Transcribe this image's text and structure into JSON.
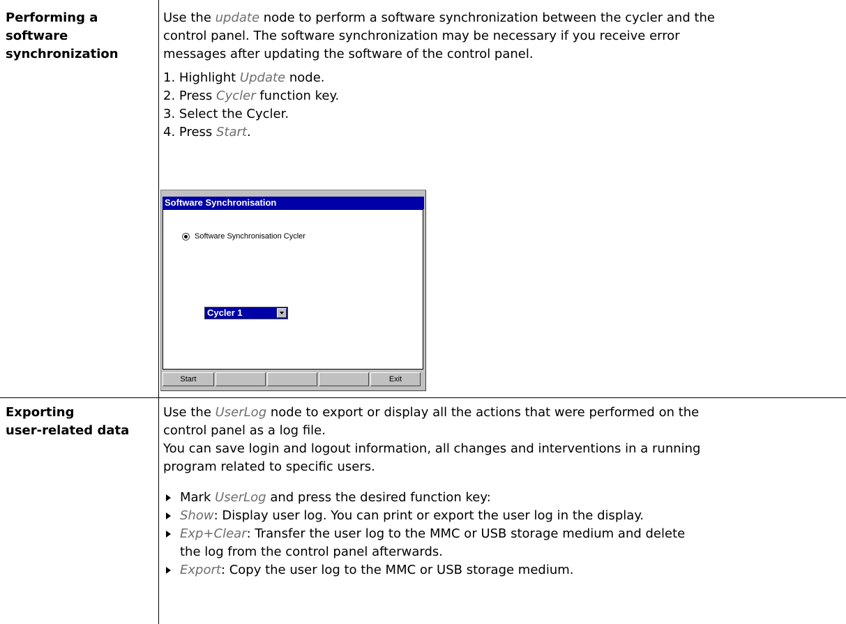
{
  "sections": [
    {
      "label_lines": [
        "Performing a",
        "software",
        "synchronization"
      ],
      "intro": {
        "pre": "Use the ",
        "em": "update",
        "post_lines": [
          " node to perform a software synchronization between the cycler and the",
          "control panel. The software synchronization may be necessary if you receive error",
          "messages after updating the software of the control panel."
        ]
      },
      "steps": [
        {
          "num": "1.",
          "pre": "Highlight ",
          "em": "Update",
          "post": " node."
        },
        {
          "num": "2.",
          "pre": "Press ",
          "em": "Cycler",
          "post": " function key."
        },
        {
          "num": "3.",
          "pre": " Select the Cycler.",
          "em": "",
          "post": ""
        },
        {
          "num": "4.",
          "pre": "Press ",
          "em": "Start",
          "post": "."
        }
      ]
    },
    {
      "label_lines": [
        "Exporting",
        "user-related data"
      ],
      "intro": {
        "pre": "Use the ",
        "em": "UserLog",
        "post_lines": [
          " node to export or display all the actions that were performed on the",
          "control panel as a log file.",
          "You can save login and logout information, all changes and interventions in a running",
          "program related to specific users."
        ]
      },
      "bullets": [
        {
          "em": "",
          "pre": "Mark ",
          "em2": "UserLog",
          "post": " and press the desired function key:"
        },
        {
          "em": "Show",
          "post": ": Display user log. You can print or export the user log in the display."
        },
        {
          "em": "Exp+Clear",
          "post": ": Transfer the user log to the MMC or USB storage medium and delete",
          "post2": "the log from the control panel afterwards."
        },
        {
          "em": "Export",
          "post": ": Copy the user log to the MMC or USB storage medium."
        }
      ]
    }
  ],
  "dialog": {
    "title": "Software Synchronisation",
    "radio_label": "Software Synchronisation Cycler",
    "select_value": "Cycler 1",
    "buttons": [
      "Start",
      "",
      "",
      "",
      "Exit"
    ],
    "colors": {
      "titlebar": "#0000a8",
      "face": "#c0c0c0"
    }
  }
}
